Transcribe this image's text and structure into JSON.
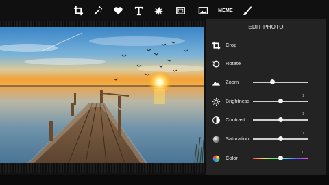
{
  "toolbar": {
    "tools": [
      {
        "name": "crop-tool-icon"
      },
      {
        "name": "magic-wand-tool-icon"
      },
      {
        "name": "heart-sticker-tool-icon"
      },
      {
        "name": "text-tool-icon",
        "glyph": "T"
      },
      {
        "name": "splash-tool-icon"
      },
      {
        "name": "frame-tool-icon"
      },
      {
        "name": "photo-tool-icon"
      },
      {
        "name": "meme-tool",
        "label": "MEME"
      },
      {
        "name": "brush-tool-icon"
      }
    ]
  },
  "panel": {
    "title": "EDIT PHOTO",
    "items": [
      {
        "label": "Crop",
        "icon": "crop-icon"
      },
      {
        "label": "Rotate",
        "icon": "rotate-icon"
      },
      {
        "label": "Zoom",
        "icon": "zoom-mountain-icon",
        "level": 0.35
      },
      {
        "label": "Brightness",
        "icon": "sun-icon",
        "level": 0.5,
        "value": "1"
      },
      {
        "label": "Contrast",
        "icon": "contrast-icon",
        "level": 0.5,
        "value": "1"
      },
      {
        "label": "Saturation",
        "icon": "saturation-icon",
        "level": 0.5,
        "value": "1"
      },
      {
        "label": "Color",
        "icon": "color-icon",
        "level": 0.5,
        "value": "0"
      }
    ]
  }
}
